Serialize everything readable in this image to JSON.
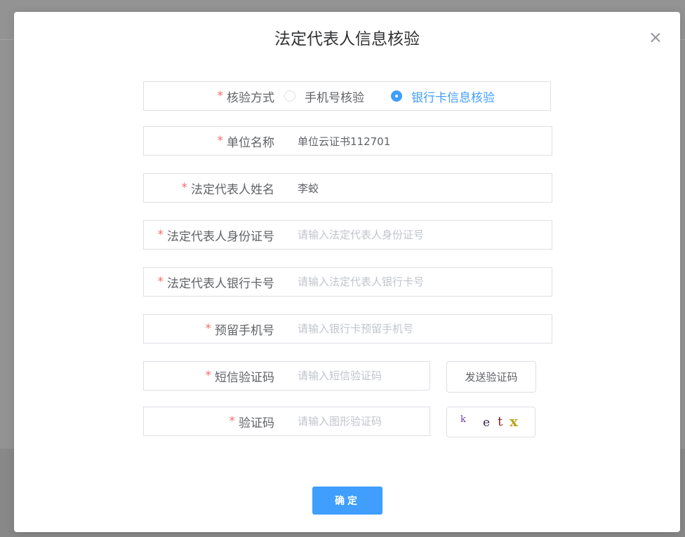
{
  "dialog": {
    "title": "法定代表人信息核验",
    "close_label": "×"
  },
  "form": {
    "verify_method": {
      "required_mark": "*",
      "label": "核验方式",
      "options": [
        {
          "label": "手机号核验",
          "checked": false
        },
        {
          "label": "银行卡信息核验",
          "checked": true
        }
      ]
    },
    "unit_name": {
      "required_mark": "*",
      "label": "单位名称",
      "value": "单位云证书112701"
    },
    "legal_rep_name": {
      "required_mark": "*",
      "label": "法定代表人姓名",
      "value": "李蛟"
    },
    "legal_rep_id": {
      "required_mark": "*",
      "label": "法定代表人身份证号",
      "placeholder": "请输入法定代表人身份证号"
    },
    "legal_rep_bank_card": {
      "required_mark": "*",
      "label": "法定代表人银行卡号",
      "placeholder": "请输入法定代表人银行卡号"
    },
    "reserved_phone": {
      "required_mark": "*",
      "label": "预留手机号",
      "placeholder": "请输入银行卡预留手机号"
    },
    "sms_code": {
      "required_mark": "*",
      "label": "短信验证码",
      "placeholder": "请输入短信验证码",
      "send_button_label": "发送验证码"
    },
    "captcha": {
      "required_mark": "*",
      "label": "验证码",
      "placeholder": "请输入图形验证码",
      "image_chars": [
        {
          "char": "k",
          "color": "#6b3fa0"
        },
        {
          "char": "e",
          "color": "#3a2a4a"
        },
        {
          "char": "t",
          "color": "#8a1f2a"
        },
        {
          "char": "x",
          "color": "#b8a41a"
        }
      ]
    }
  },
  "footer": {
    "confirm_label": "确定"
  },
  "colors": {
    "primary": "#409eff",
    "required": "#f56c6c",
    "border": "#dcdfe6",
    "placeholder": "#c0c4cc",
    "text": "#606266",
    "overlay": "#939393"
  }
}
